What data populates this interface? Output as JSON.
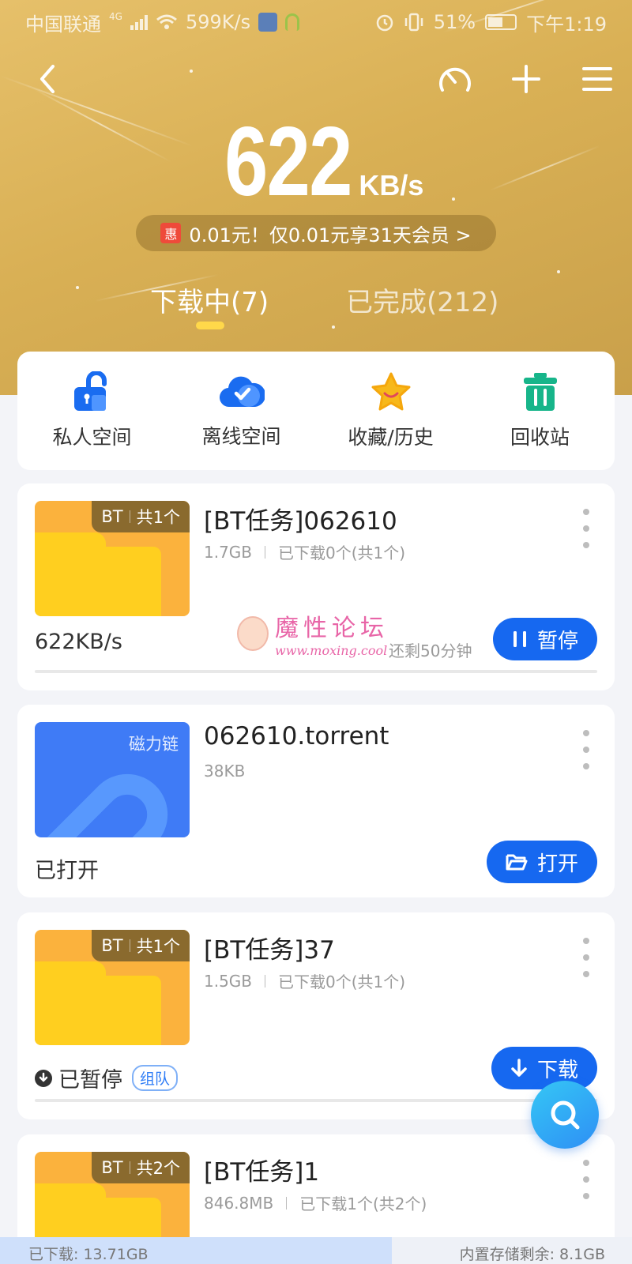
{
  "status_bar": {
    "carrier": "中国联通",
    "network": "4G",
    "net_speed": "599K/s",
    "battery": "51%",
    "time": "下午1:19"
  },
  "header": {
    "speed_value": "622",
    "speed_unit": "KB/s",
    "promo_tag": "惠",
    "promo_text": "0.01元！仅0.01元享31天会员 >"
  },
  "tabs": [
    {
      "label": "下载中(7)",
      "active": true
    },
    {
      "label": "已完成(212)",
      "active": false
    }
  ],
  "shortcuts": [
    {
      "label": "私人空间",
      "icon": "lock-icon",
      "color": "#1a6cf0"
    },
    {
      "label": "离线空间",
      "icon": "cloud-check-icon",
      "color": "#1a6cf0"
    },
    {
      "label": "收藏/历史",
      "icon": "star-icon",
      "color": "#f5b312"
    },
    {
      "label": "回收站",
      "icon": "trash-icon",
      "color": "#17b58a"
    }
  ],
  "tasks": [
    {
      "badge_type": "BT",
      "badge_count": "共1个",
      "title": "[BT任务]062610",
      "size": "1.7GB",
      "downloaded": "已下载0个(共1个)",
      "status": "622KB/s",
      "remaining": "还剩50分钟",
      "action": "暂停",
      "progress": 0
    },
    {
      "badge_type": "磁力链",
      "title": "062610.torrent",
      "size": "38KB",
      "status": "已打开",
      "action": "打开"
    },
    {
      "badge_type": "BT",
      "badge_count": "共1个",
      "title": "[BT任务]37",
      "size": "1.5GB",
      "downloaded": "已下载0个(共1个)",
      "status": "已暂停",
      "status_tag": "组队",
      "action": "下载",
      "progress": 0
    },
    {
      "badge_type": "BT",
      "badge_count": "共2个",
      "title": "[BT任务]1",
      "size": "846.8MB",
      "downloaded": "已下载1个(共2个)"
    }
  ],
  "watermark": {
    "title": "魔性论坛",
    "url": "www.moxing.cool"
  },
  "footer": {
    "downloaded": "已下载: 13.71GB",
    "storage_left": "内置存储剩余: 8.1GB",
    "usage_fraction": 0.62
  },
  "colors": {
    "accent_blue": "#1668f0",
    "header_gold": "#d9b055",
    "folder_orange": "#fbb23d",
    "folder_yellow": "#ffcf1f",
    "magnet_blue": "#3f7bf6"
  }
}
